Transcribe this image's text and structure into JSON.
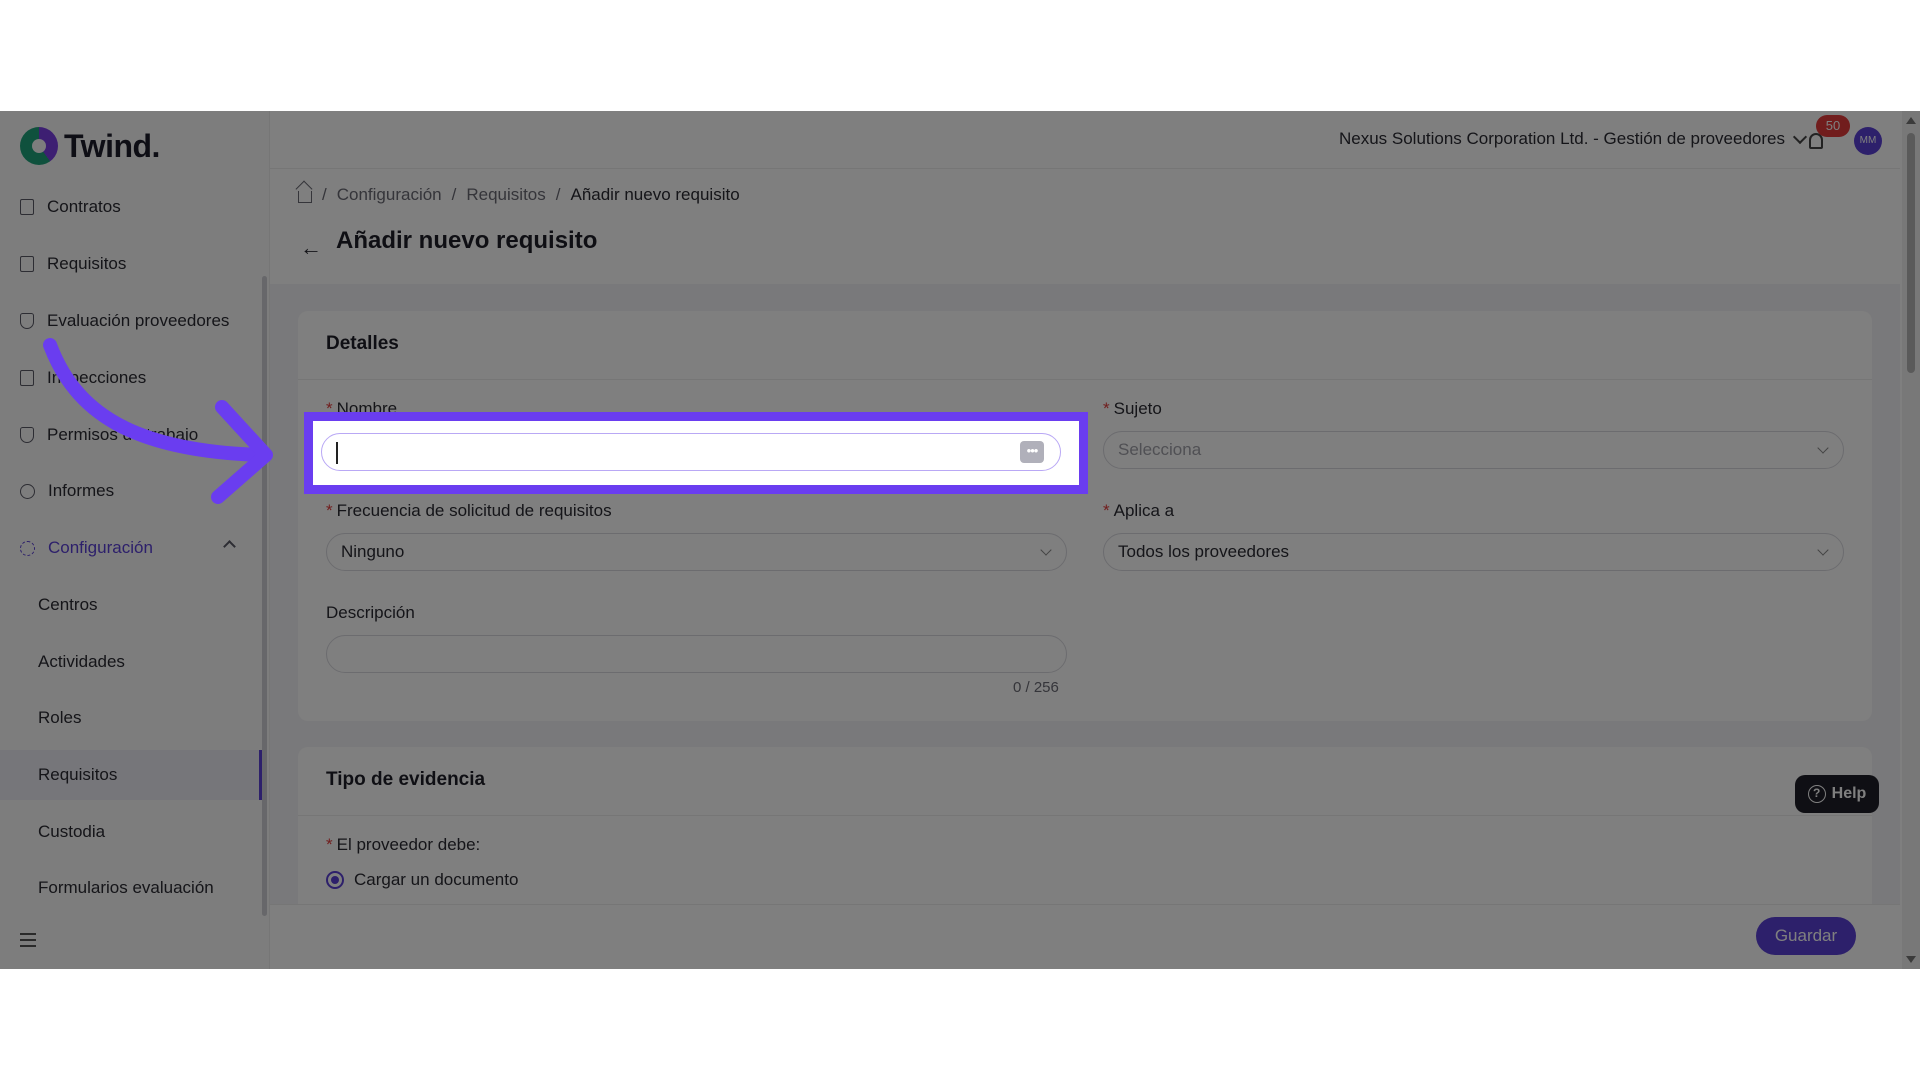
{
  "brand": {
    "name": "Twind."
  },
  "sidebar": {
    "items": [
      {
        "label": "Contratos",
        "icon": "document-icon"
      },
      {
        "label": "Requisitos",
        "icon": "file-icon"
      },
      {
        "label": "Evaluación proveedores",
        "icon": "shield-check-icon"
      },
      {
        "label": "Inspecciones",
        "icon": "inspection-icon"
      },
      {
        "label": "Permisos de trabajo",
        "icon": "permit-shield-icon"
      },
      {
        "label": "Informes",
        "icon": "pie-chart-icon"
      },
      {
        "label": "Configuración",
        "icon": "gear-icon",
        "expanded": true
      }
    ],
    "subitems": [
      {
        "label": "Centros"
      },
      {
        "label": "Actividades"
      },
      {
        "label": "Roles"
      },
      {
        "label": "Requisitos",
        "selected": true
      },
      {
        "label": "Custodia"
      },
      {
        "label": "Formularios evaluación"
      }
    ]
  },
  "topbar": {
    "org_selector": "Nexus Solutions Corporation Ltd. - Gestión de proveedores",
    "notification_count": "50",
    "avatar_initials": "MM"
  },
  "breadcrumb": {
    "items": [
      "Configuración",
      "Requisitos"
    ],
    "current": "Añadir nuevo requisito",
    "separator": "/"
  },
  "page": {
    "title": "Añadir nuevo requisito"
  },
  "details": {
    "title": "Detalles",
    "nombre": {
      "label": "Nombre",
      "value": ""
    },
    "sujeto": {
      "label": "Sujeto",
      "placeholder": "Selecciona"
    },
    "frecuencia": {
      "label": "Frecuencia de solicitud de requisitos",
      "value": "Ninguno"
    },
    "aplica": {
      "label": "Aplica a",
      "value": "Todos los proveedores"
    },
    "descripcion": {
      "label": "Descripción",
      "value": "",
      "counter": "0 / 256"
    }
  },
  "evidence": {
    "title": "Tipo de evidencia",
    "prompt": "El proveedor debe:",
    "options": [
      {
        "label": "Cargar un documento",
        "selected": true
      }
    ]
  },
  "actions": {
    "save_label": "Guardar",
    "help_label": "Help"
  },
  "colors": {
    "accent": "#5b40d6",
    "highlight": "#6a3df0",
    "badge": "#e23b3b"
  }
}
